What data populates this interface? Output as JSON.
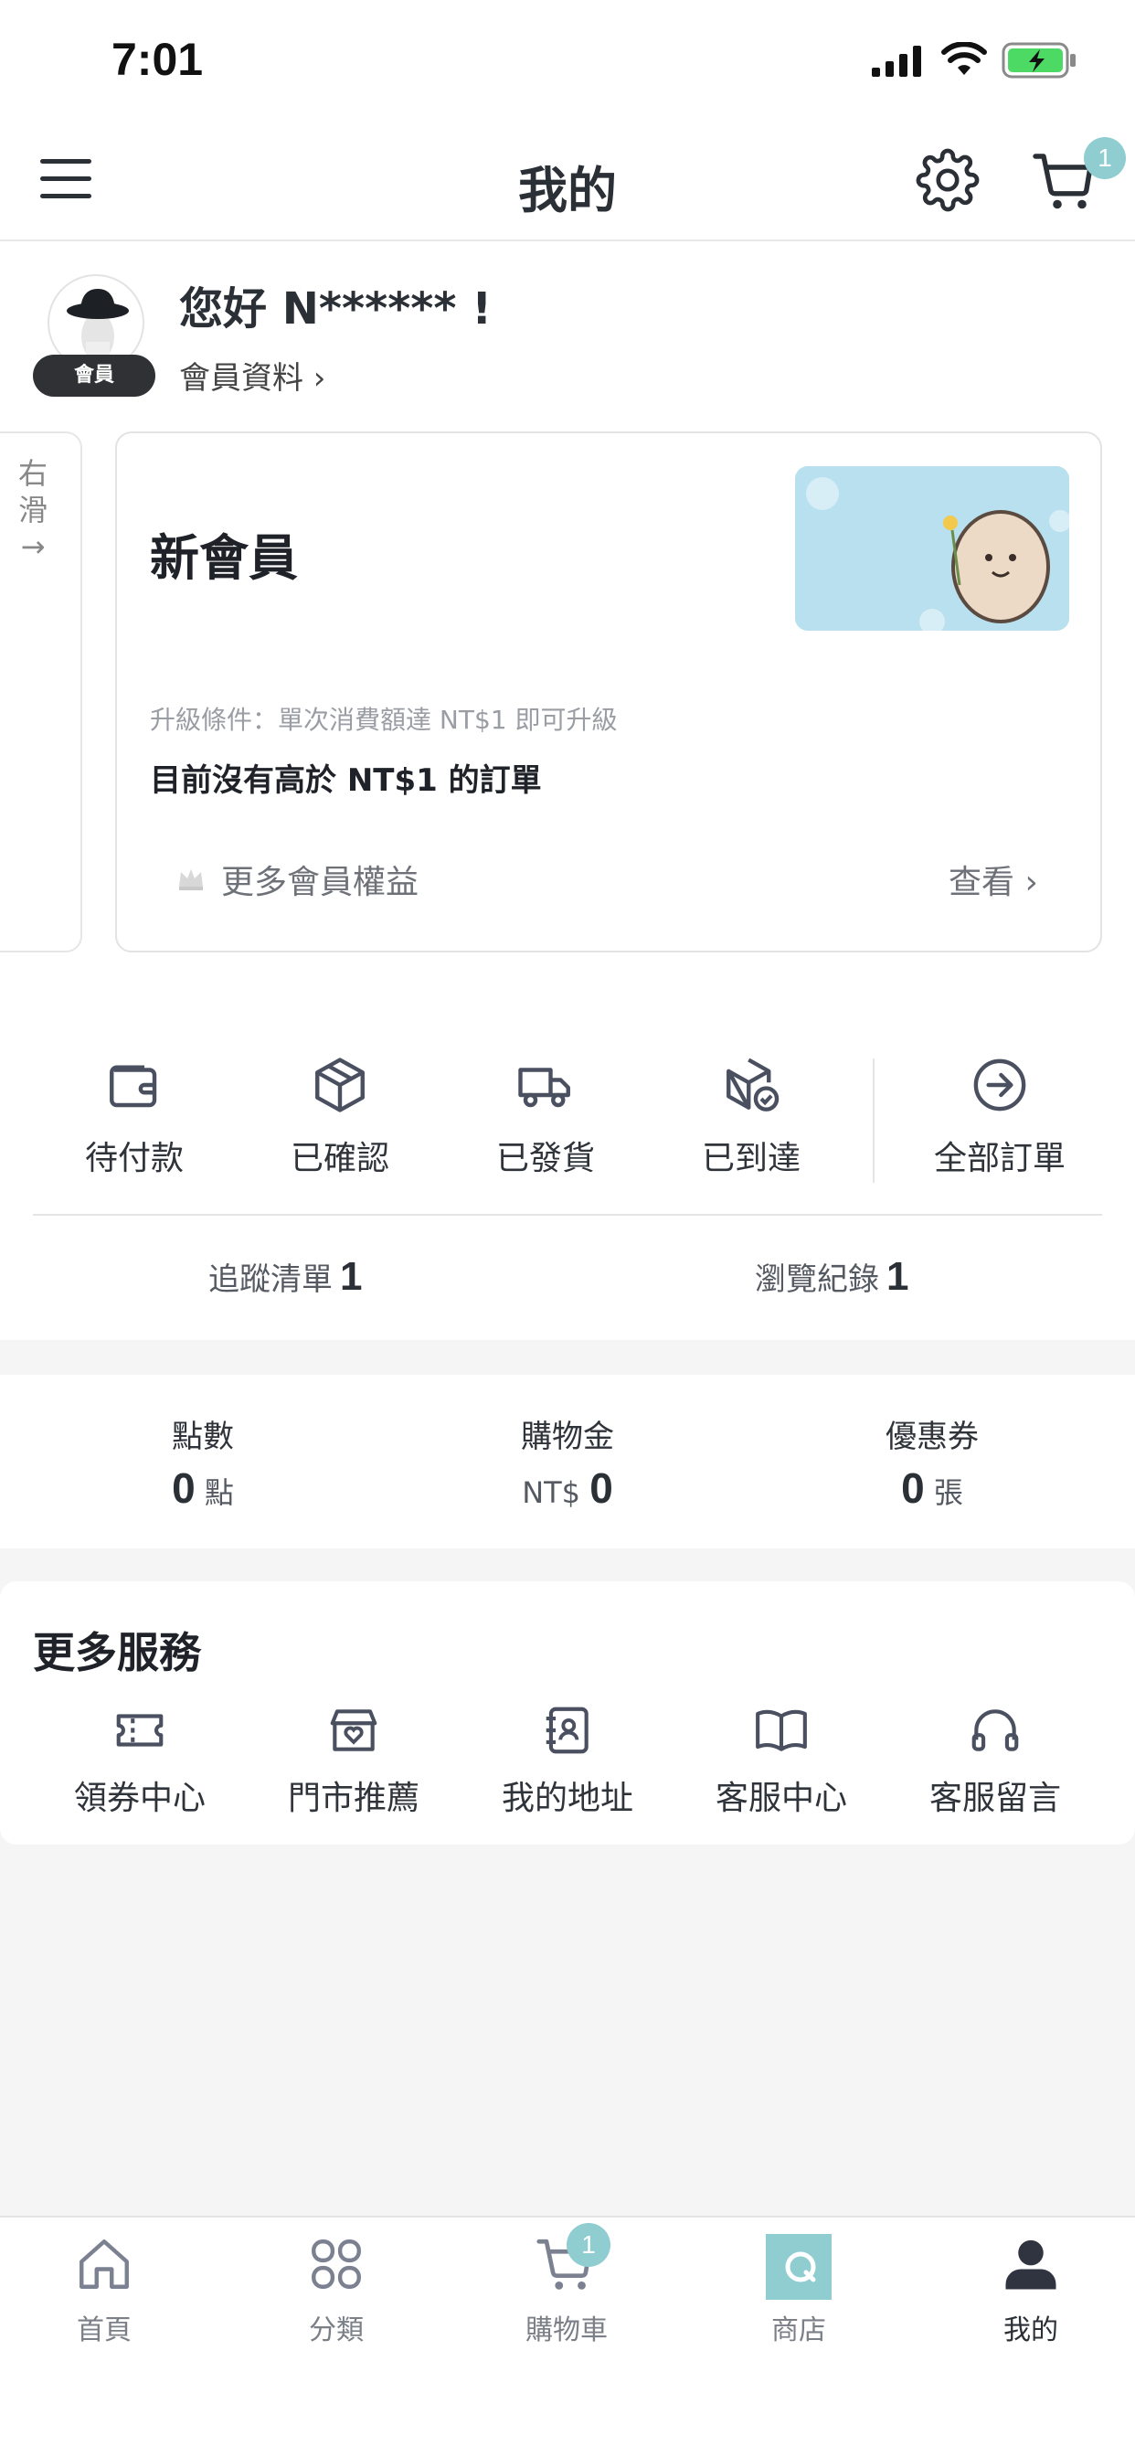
{
  "status_bar": {
    "time": "7:01"
  },
  "header": {
    "title": "我的",
    "cart_count": "1"
  },
  "profile": {
    "greeting": "您好 N****** !",
    "member_badge": "會員",
    "profile_link": "會員資料 ›"
  },
  "swipe_hint": "右\n滑\n→",
  "member_card": {
    "tier": "新會員",
    "upgrade_condition": "升級條件：單次消費額達 NT$1 即可升級",
    "order_status": "目前沒有高於 NT$1 的訂單",
    "more_benefits": "更多會員權益",
    "view": "查看 ›"
  },
  "orders": {
    "items": [
      {
        "label": "待付款",
        "icon": "wallet-icon"
      },
      {
        "label": "已確認",
        "icon": "box-icon"
      },
      {
        "label": "已發貨",
        "icon": "truck-icon"
      },
      {
        "label": "已到達",
        "icon": "box-check-icon"
      },
      {
        "label": "全部訂單",
        "icon": "arrow-circle-icon"
      }
    ],
    "wishlist_label": "追蹤清單",
    "wishlist_count": "1",
    "history_label": "瀏覽紀錄",
    "history_count": "1"
  },
  "wallet": {
    "points_label": "點數",
    "points_value": "0",
    "points_unit": "點",
    "credit_label": "購物金",
    "credit_prefix": "NT$",
    "credit_value": "0",
    "coupon_label": "優惠券",
    "coupon_value": "0",
    "coupon_unit": "張"
  },
  "services": {
    "title": "更多服務",
    "items": [
      {
        "label": "領券中心",
        "icon": "ticket-icon"
      },
      {
        "label": "門市推薦",
        "icon": "store-heart-icon"
      },
      {
        "label": "我的地址",
        "icon": "address-book-icon"
      },
      {
        "label": "客服中心",
        "icon": "book-icon"
      },
      {
        "label": "客服留言",
        "icon": "headphones-icon"
      }
    ]
  },
  "tabbar": {
    "items": [
      {
        "label": "首頁",
        "icon": "home-icon"
      },
      {
        "label": "分類",
        "icon": "grid-icon"
      },
      {
        "label": "購物車",
        "icon": "cart-icon"
      },
      {
        "label": "商店",
        "icon": "store-logo-icon"
      },
      {
        "label": "我的",
        "icon": "user-icon"
      }
    ],
    "cart_count": "1"
  },
  "colors": {
    "accent": "#8fcdd0",
    "text": "#2b2f36",
    "background": "#f5f5f6"
  }
}
